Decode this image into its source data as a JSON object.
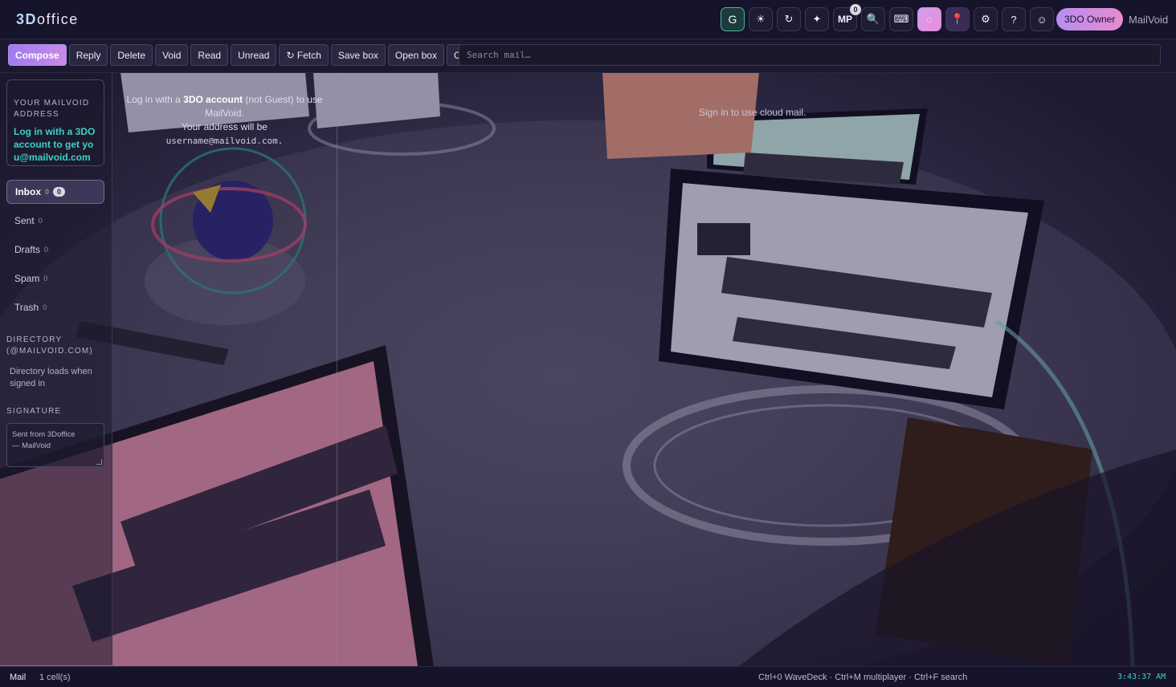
{
  "app": {
    "logo_bold": "3D",
    "logo_rest": "office",
    "name": "MailVoid"
  },
  "topbar": {
    "icons": [
      {
        "name": "g-icon",
        "glyph": "G"
      },
      {
        "name": "brightness-icon",
        "glyph": "☀"
      },
      {
        "name": "refresh-icon",
        "glyph": "↻"
      },
      {
        "name": "sparkle-icon",
        "glyph": "✦"
      },
      {
        "name": "multiplayer-icon",
        "glyph": "MP",
        "badge": "0"
      },
      {
        "name": "search-icon",
        "glyph": "🔍"
      },
      {
        "name": "keyboard-icon",
        "glyph": "⌨"
      },
      {
        "name": "shield-icon",
        "glyph": "◌"
      },
      {
        "name": "pin-icon",
        "glyph": "📍"
      },
      {
        "name": "gear-icon",
        "glyph": "⚙"
      },
      {
        "name": "help-icon",
        "glyph": "?"
      },
      {
        "name": "avatar-icon",
        "glyph": "☺"
      }
    ],
    "owner_label": "3DO Owner"
  },
  "toolbar": {
    "buttons": [
      "Compose",
      "Reply",
      "Delete",
      "Void",
      "Read",
      "Unread",
      "↻ Fetch",
      "Save box",
      "Open box",
      "Orbit"
    ],
    "search_placeholder": "Search mail…"
  },
  "sidebar": {
    "address_title": "YOUR MAILVOID ADDRESS",
    "address_msg": "Log in with a 3DO account to get you@mailvoid.com",
    "folders": [
      {
        "label": "Inbox",
        "count": "0",
        "pill": "0"
      },
      {
        "label": "Sent",
        "count": "0"
      },
      {
        "label": "Drafts",
        "count": "0"
      },
      {
        "label": "Spam",
        "count": "0"
      },
      {
        "label": "Trash",
        "count": "0"
      }
    ],
    "directory_title": "DIRECTORY (@MAILVOID.COM)",
    "directory_note": "Directory loads when signed in",
    "signature_title": "SIGNATURE",
    "signature_text": "Sent from 3Doffice\n— MailVoid"
  },
  "list": {
    "login_pre": "Log in with a ",
    "login_bold": "3DO account",
    "login_post": " (not Guest) to use MailVoid.",
    "login_line2": "Your address will be",
    "login_addr": "username@mailvoid.com."
  },
  "reader": {
    "message": "Sign in to use cloud mail."
  },
  "status": {
    "mode": "Mail",
    "cells": "1 cell(s)",
    "hint": "Ctrl+0 WaveDeck · Ctrl+M multiplayer · Ctrl+F search",
    "clock": "3:43:37 AM"
  }
}
